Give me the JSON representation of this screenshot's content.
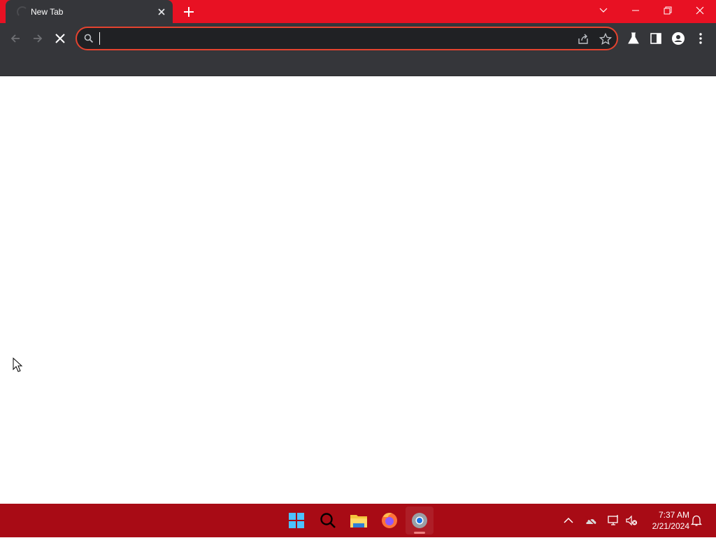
{
  "browser": {
    "tab": {
      "title": "New Tab"
    },
    "omnibox": {
      "value": "",
      "placeholder": ""
    }
  },
  "taskbar": {
    "clock": {
      "time": "7:37 AM",
      "date": "2/21/2024"
    },
    "apps": [
      "start-icon",
      "search-icon",
      "file-explorer-icon",
      "firefox-icon",
      "chrome-icon"
    ]
  },
  "colors": {
    "title_bar": "#e81123",
    "toolbar": "#35363a",
    "omnibox_border": "#e5432f",
    "taskbar": "#a80b15"
  }
}
